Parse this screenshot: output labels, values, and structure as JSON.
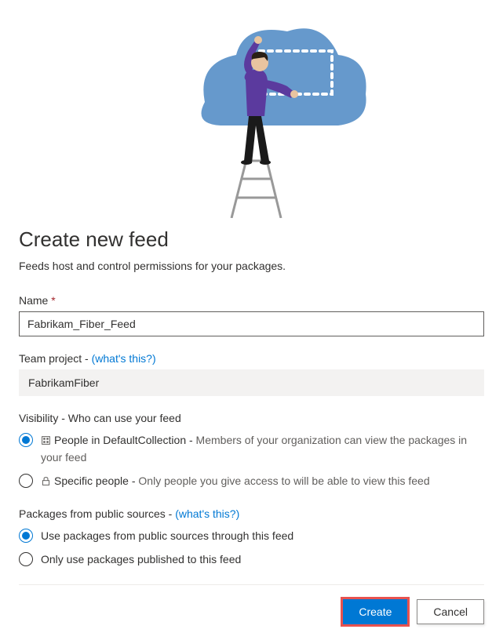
{
  "title": "Create new feed",
  "subtitle": "Feeds host and control permissions for your packages.",
  "name_section": {
    "label": "Name",
    "required_marker": "*",
    "value": "Fabrikam_Fiber_Feed"
  },
  "team_project_section": {
    "label": "Team project - ",
    "help_link": "(what's this?)",
    "value": "FabrikamFiber"
  },
  "visibility_section": {
    "label": "Visibility - Who can use your feed",
    "options": [
      {
        "selected": true,
        "label_strong": "People in DefaultCollection - ",
        "label_desc": "Members of your organization can view the packages in your feed"
      },
      {
        "selected": false,
        "label_strong": "Specific people - ",
        "label_desc": "Only people you give access to will be able to view this feed"
      }
    ]
  },
  "packages_section": {
    "label": "Packages from public sources - ",
    "help_link": "(what's this?)",
    "options": [
      {
        "selected": true,
        "label": "Use packages from public sources through this feed"
      },
      {
        "selected": false,
        "label": "Only use packages published to this feed"
      }
    ]
  },
  "footer": {
    "create_label": "Create",
    "cancel_label": "Cancel"
  }
}
